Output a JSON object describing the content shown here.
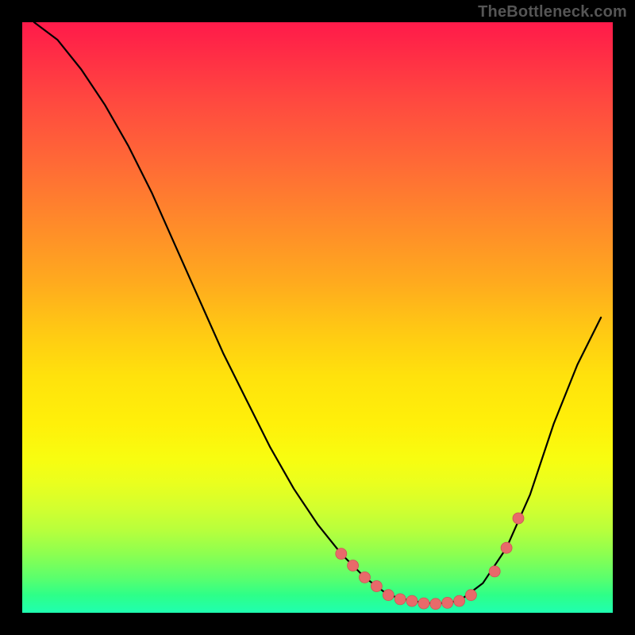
{
  "watermark": "TheBottleneck.com",
  "colors": {
    "background": "#000000",
    "gradient_top": "#ff1a4a",
    "gradient_bottom": "#1fffb0",
    "curve": "#000000",
    "markers": "#e86a6a"
  },
  "chart_data": {
    "type": "line",
    "title": "",
    "xlabel": "",
    "ylabel": "",
    "xlim": [
      0,
      100
    ],
    "ylim": [
      0,
      100
    ],
    "grid": false,
    "legend": false,
    "series": [
      {
        "name": "bottleneck-curve",
        "x": [
          2,
          6,
          10,
          14,
          18,
          22,
          26,
          30,
          34,
          38,
          42,
          46,
          50,
          54,
          58,
          62,
          66,
          70,
          74,
          78,
          82,
          86,
          90,
          94,
          98
        ],
        "y": [
          100,
          97,
          92,
          86,
          79,
          71,
          62,
          53,
          44,
          36,
          28,
          21,
          15,
          10,
          6,
          3,
          2,
          1.5,
          2,
          5,
          11,
          20,
          32,
          42,
          50
        ]
      }
    ],
    "highlighted_points": {
      "x": [
        54,
        56,
        58,
        60,
        62,
        64,
        66,
        68,
        70,
        72,
        74,
        76,
        80,
        82,
        84
      ],
      "y": [
        10,
        8,
        6,
        4.5,
        3,
        2.3,
        2,
        1.6,
        1.5,
        1.7,
        2,
        3,
        7,
        11,
        16
      ]
    },
    "annotations": []
  }
}
